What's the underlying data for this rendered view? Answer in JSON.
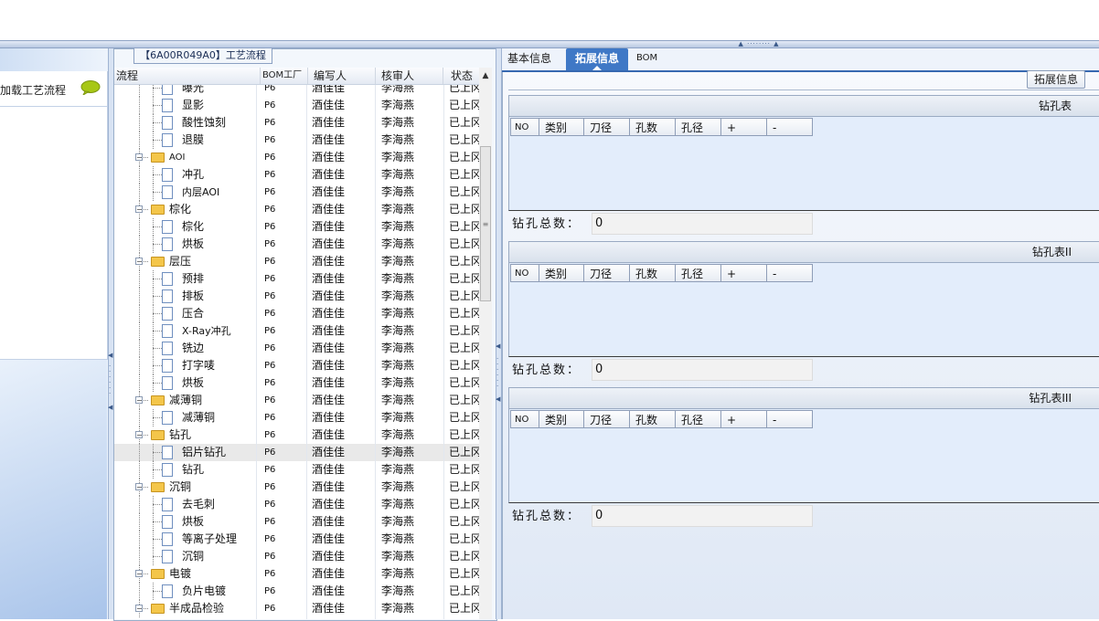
{
  "left": {
    "item_label": "加载工艺流程",
    "chat_icon": "speech-bubble-icon"
  },
  "tree": {
    "title": "【6A00R049A0】工艺流程",
    "columns": {
      "flow": "流程",
      "bom": "BOM工厂",
      "writer": "编写人",
      "reviewer": "核审人",
      "status": "状态"
    },
    "rows": [
      {
        "label": "曝光",
        "type": "doc",
        "bom": "P6",
        "writer": "酒佳佳",
        "reviewer": "李海燕",
        "status": "已上冈"
      },
      {
        "label": "显影",
        "type": "doc",
        "bom": "P6",
        "writer": "酒佳佳",
        "reviewer": "李海燕",
        "status": "已上冈"
      },
      {
        "label": "酸性蚀刻",
        "type": "doc",
        "bom": "P6",
        "writer": "酒佳佳",
        "reviewer": "李海燕",
        "status": "已上冈"
      },
      {
        "label": "退膜",
        "type": "doc",
        "bom": "P6",
        "writer": "酒佳佳",
        "reviewer": "李海燕",
        "status": "已上冈"
      },
      {
        "label": "AOI",
        "type": "folder",
        "bom": "P6",
        "writer": "酒佳佳",
        "reviewer": "李海燕",
        "status": "已上冈"
      },
      {
        "label": "冲孔",
        "type": "doc",
        "bom": "P6",
        "writer": "酒佳佳",
        "reviewer": "李海燕",
        "status": "已上冈"
      },
      {
        "label": "内层AOI",
        "type": "doc",
        "bom": "P6",
        "writer": "酒佳佳",
        "reviewer": "李海燕",
        "status": "已上冈"
      },
      {
        "label": "棕化",
        "type": "folder",
        "bom": "P6",
        "writer": "酒佳佳",
        "reviewer": "李海燕",
        "status": "已上冈"
      },
      {
        "label": "棕化",
        "type": "doc",
        "bom": "P6",
        "writer": "酒佳佳",
        "reviewer": "李海燕",
        "status": "已上冈"
      },
      {
        "label": "烘板",
        "type": "doc",
        "bom": "P6",
        "writer": "酒佳佳",
        "reviewer": "李海燕",
        "status": "已上冈"
      },
      {
        "label": "层压",
        "type": "folder",
        "bom": "P6",
        "writer": "酒佳佳",
        "reviewer": "李海燕",
        "status": "已上冈"
      },
      {
        "label": "预排",
        "type": "doc",
        "bom": "P6",
        "writer": "酒佳佳",
        "reviewer": "李海燕",
        "status": "已上冈"
      },
      {
        "label": "排板",
        "type": "doc",
        "bom": "P6",
        "writer": "酒佳佳",
        "reviewer": "李海燕",
        "status": "已上冈"
      },
      {
        "label": "压合",
        "type": "doc",
        "bom": "P6",
        "writer": "酒佳佳",
        "reviewer": "李海燕",
        "status": "已上冈"
      },
      {
        "label": "X-Ray冲孔",
        "type": "doc",
        "bom": "P6",
        "writer": "酒佳佳",
        "reviewer": "李海燕",
        "status": "已上冈"
      },
      {
        "label": "铣边",
        "type": "doc",
        "bom": "P6",
        "writer": "酒佳佳",
        "reviewer": "李海燕",
        "status": "已上冈"
      },
      {
        "label": "打字唛",
        "type": "doc",
        "bom": "P6",
        "writer": "酒佳佳",
        "reviewer": "李海燕",
        "status": "已上冈"
      },
      {
        "label": "烘板",
        "type": "doc",
        "bom": "P6",
        "writer": "酒佳佳",
        "reviewer": "李海燕",
        "status": "已上冈"
      },
      {
        "label": "减薄铜",
        "type": "folder",
        "bom": "P6",
        "writer": "酒佳佳",
        "reviewer": "李海燕",
        "status": "已上冈"
      },
      {
        "label": "减薄铜",
        "type": "doc",
        "bom": "P6",
        "writer": "酒佳佳",
        "reviewer": "李海燕",
        "status": "已上冈"
      },
      {
        "label": "钻孔",
        "type": "folder",
        "bom": "P6",
        "writer": "酒佳佳",
        "reviewer": "李海燕",
        "status": "已上冈"
      },
      {
        "label": "铝片钻孔",
        "type": "doc",
        "bom": "P6",
        "writer": "酒佳佳",
        "reviewer": "李海燕",
        "status": "已上冈",
        "selected": true
      },
      {
        "label": "钻孔",
        "type": "doc",
        "bom": "P6",
        "writer": "酒佳佳",
        "reviewer": "李海燕",
        "status": "已上冈"
      },
      {
        "label": "沉铜",
        "type": "folder",
        "bom": "P6",
        "writer": "酒佳佳",
        "reviewer": "李海燕",
        "status": "已上冈"
      },
      {
        "label": "去毛刺",
        "type": "doc",
        "bom": "P6",
        "writer": "酒佳佳",
        "reviewer": "李海燕",
        "status": "已上冈"
      },
      {
        "label": "烘板",
        "type": "doc",
        "bom": "P6",
        "writer": "酒佳佳",
        "reviewer": "李海燕",
        "status": "已上冈"
      },
      {
        "label": "等离子处理",
        "type": "doc",
        "bom": "P6",
        "writer": "酒佳佳",
        "reviewer": "李海燕",
        "status": "已上冈"
      },
      {
        "label": "沉铜",
        "type": "doc",
        "bom": "P6",
        "writer": "酒佳佳",
        "reviewer": "李海燕",
        "status": "已上冈"
      },
      {
        "label": "电镀",
        "type": "folder",
        "bom": "P6",
        "writer": "酒佳佳",
        "reviewer": "李海燕",
        "status": "已上冈"
      },
      {
        "label": "负片电镀",
        "type": "doc",
        "bom": "P6",
        "writer": "酒佳佳",
        "reviewer": "李海燕",
        "status": "已上冈"
      },
      {
        "label": "半成品检验",
        "type": "folder",
        "bom": "P6",
        "writer": "酒佳佳",
        "reviewer": "李海燕",
        "status": "已上冈"
      }
    ]
  },
  "right": {
    "tabs": [
      "基本信息",
      "拓展信息",
      "BOM"
    ],
    "active_tab": "拓展信息",
    "ext_button": "拓展信息",
    "grid_columns": [
      "NO",
      "类别",
      "刀径",
      "孔数",
      "孔径",
      "+",
      "-"
    ],
    "count_label": "钻孔总数：",
    "sections": [
      {
        "title": "钻孔表",
        "count": "0"
      },
      {
        "title": "钻孔表II",
        "count": "0"
      },
      {
        "title": "钻孔表III",
        "count": "0"
      }
    ]
  }
}
